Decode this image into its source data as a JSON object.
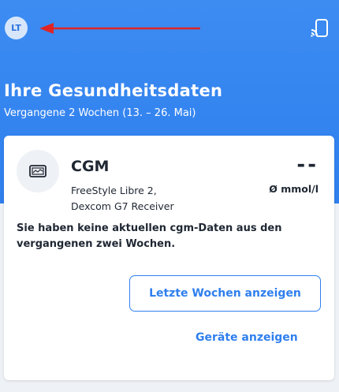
{
  "header": {
    "avatar_initials": "LT",
    "title": "Ihre Gesundheitsdaten",
    "subtitle": "Vergangene 2 Wochen (13. – 26. Mai)",
    "action_icon": "cast-icon",
    "annotation_color": "#e02424"
  },
  "card": {
    "icon": "monitor-graph-icon",
    "title": "CGM",
    "value": "--",
    "devices_line1": "FreeStyle Libre 2,",
    "devices_line2": "Dexcom G7 Receiver",
    "unit": "Ø mmol/l",
    "message": "Sie haben keine aktuellen cgm-Daten aus den vergangenen zwei Wochen.",
    "primary_button": "Letzte Wochen anzeigen",
    "secondary_button": "Geräte anzeigen"
  },
  "colors": {
    "header_blue": "#2f7fee",
    "accent": "#2f7fee",
    "text": "#1f2733",
    "background": "#eef1f5"
  }
}
